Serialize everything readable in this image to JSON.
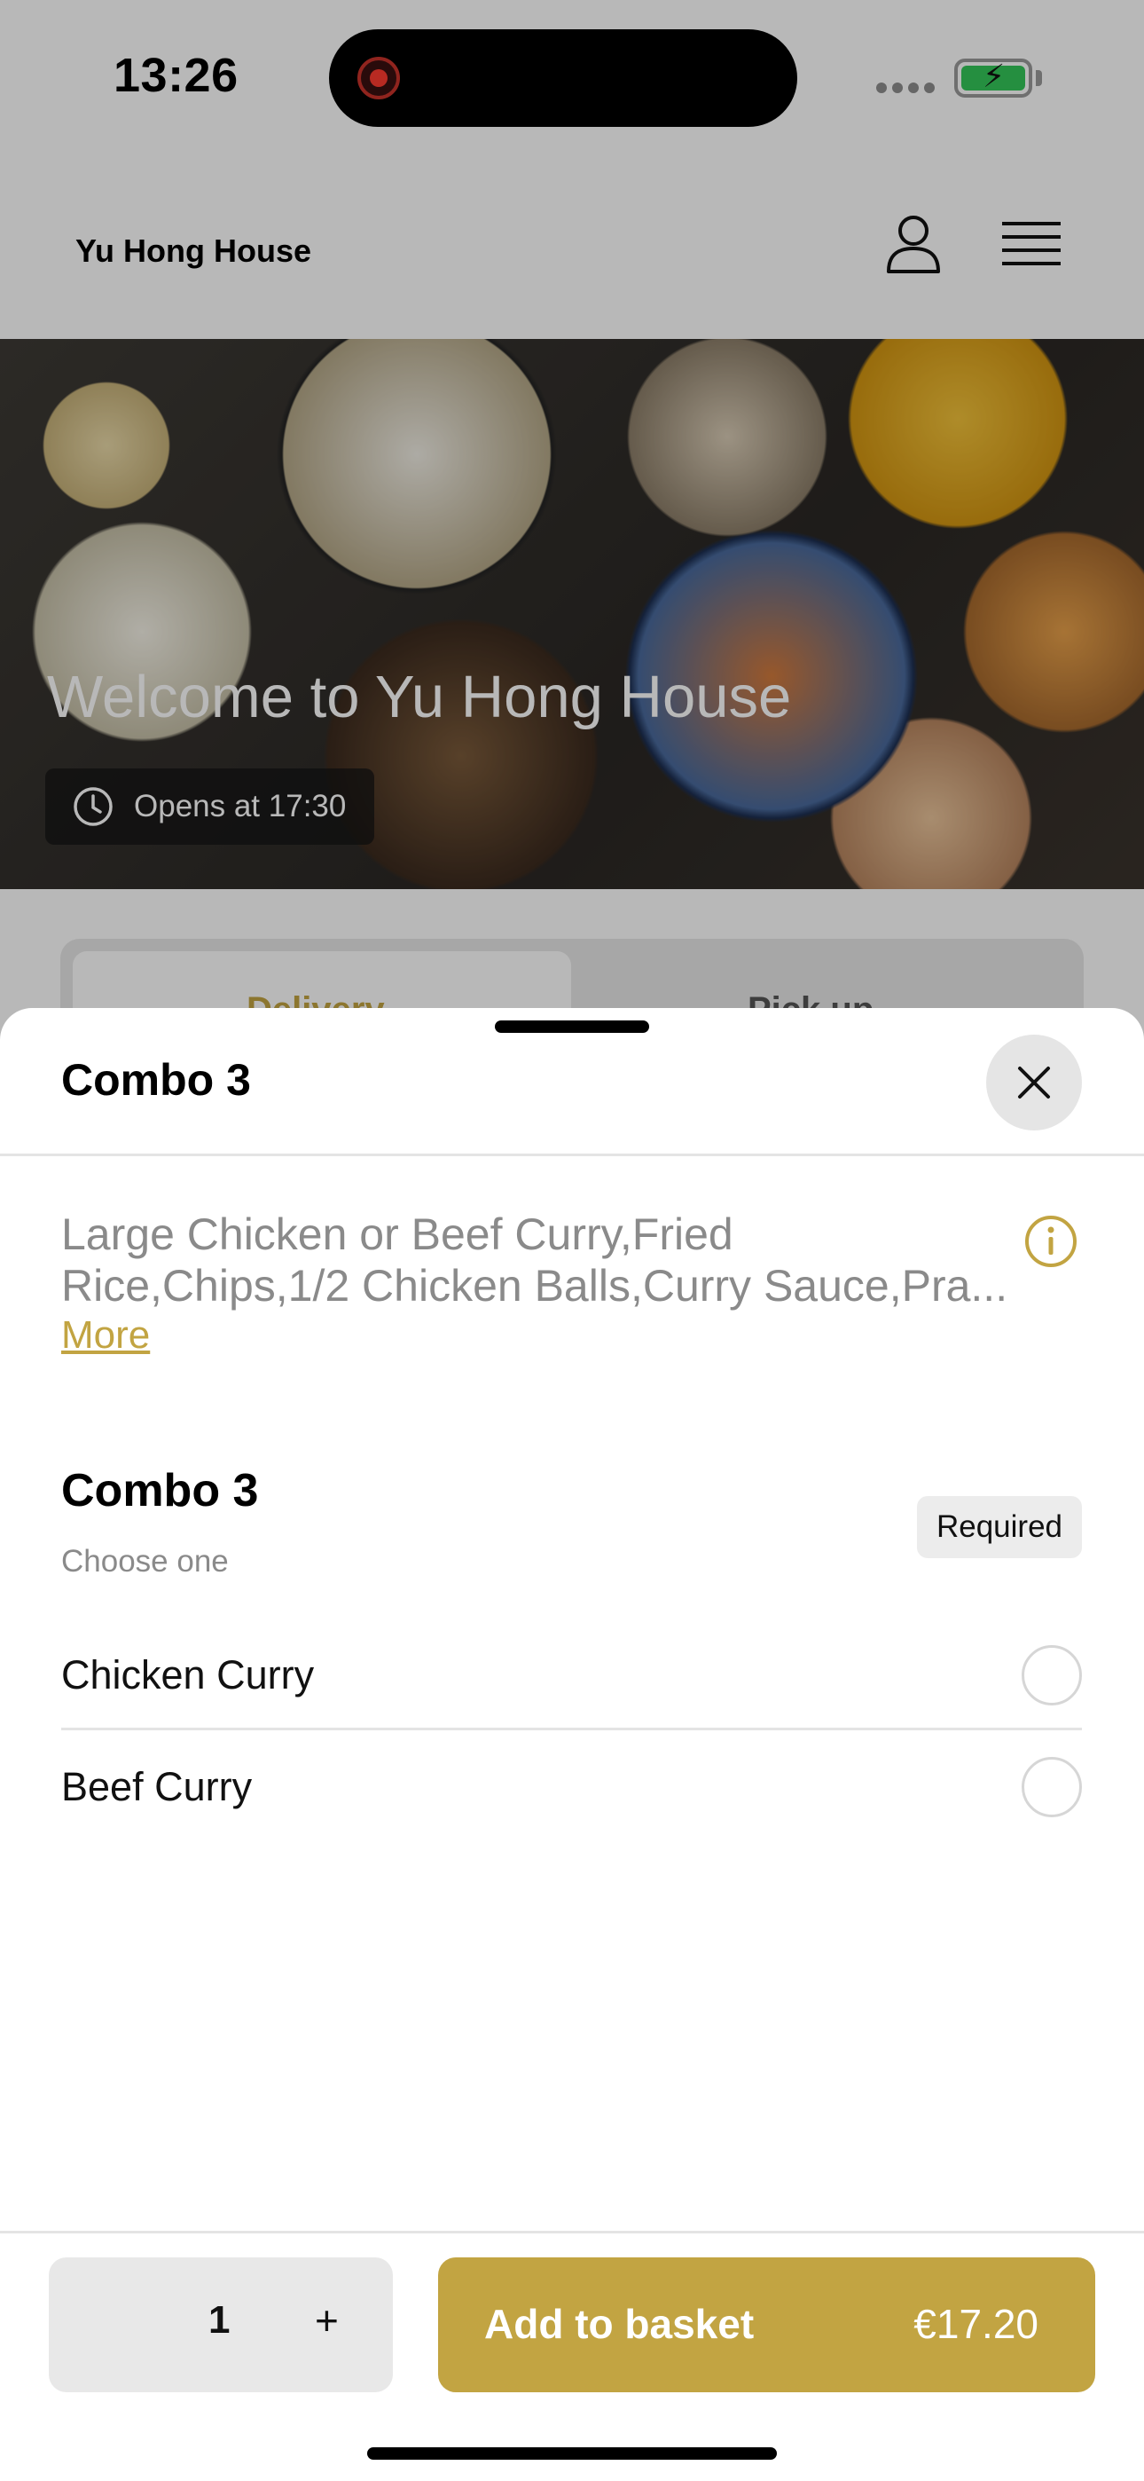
{
  "status_bar": {
    "time": "13:26",
    "recording_indicator_icon": "record-icon",
    "battery_icon": "battery-charging-icon"
  },
  "header": {
    "restaurant_name": "Yu Hong House",
    "account_icon": "user-icon",
    "menu_icon": "hamburger-menu-icon"
  },
  "hero": {
    "title": "Welcome to Yu Hong House",
    "opening_status": "Opens at 17:30",
    "clock_icon": "clock-icon"
  },
  "order_mode": {
    "options": [
      "Delivery",
      "Pick up"
    ],
    "selected": "Delivery"
  },
  "item_sheet": {
    "title": "Combo 3",
    "description_line1": "Large Chicken or Beef Curry,Fried",
    "description_line2": "Rice,Chips,1/2 Chicken Balls,Curry Sauce,Pra...",
    "more_label": "More",
    "option_group": {
      "title": "Combo 3",
      "subtitle": "Choose one",
      "badge": "Required",
      "choices": [
        {
          "label": "Chicken Curry",
          "selected": false
        },
        {
          "label": "Beef Curry",
          "selected": false
        }
      ]
    },
    "quantity": "1",
    "plus_label": "+",
    "add_button_label": "Add to basket",
    "price": "€17.20"
  },
  "colors": {
    "accent": "#c2a442",
    "scrim": "rgba(0,0,0,0.28)",
    "sheet_background": "#ffffff",
    "stepper_background": "#e8e8e8"
  }
}
